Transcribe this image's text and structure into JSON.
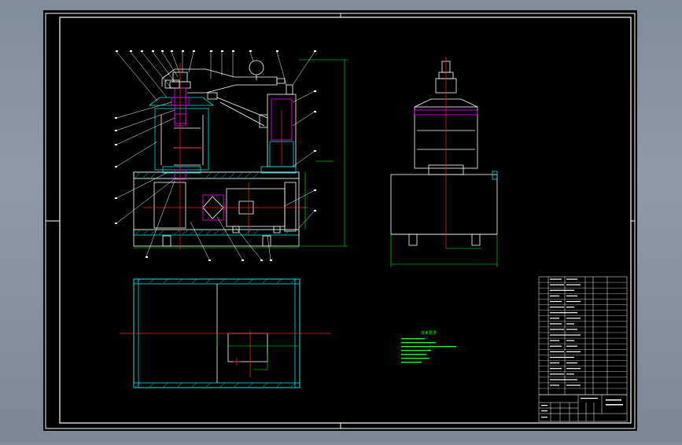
{
  "drawing": {
    "background": "#000000",
    "frame_color": "#ffffff",
    "colors": {
      "outline": "#ffffff",
      "hatch": "#00e5e5",
      "centerline": "#ff2020",
      "dimension": "#00ff00",
      "highlight": "#ff00ff",
      "callout": "#ffffff"
    },
    "notes_block": {
      "title": "技术要求",
      "lines": [
        "",
        "",
        "",
        "",
        "",
        "",
        ""
      ]
    },
    "title_block": {
      "label": ""
    }
  }
}
